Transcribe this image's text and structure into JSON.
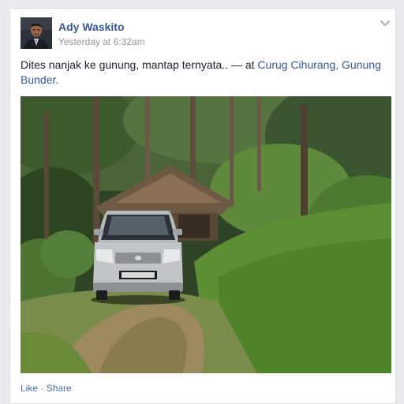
{
  "post": {
    "author_name": "Ady Waskito",
    "timestamp": "Yesterday at 6:32am",
    "message": "Dites nanjak ke gunung, mantap ternyata..",
    "at_separator": " — at ",
    "location": "Curug Cihurang, Gunung Bunder",
    "location_suffix": ".",
    "options_icon": "chevron-down-icon",
    "photo_subject": "silver-minivan-on-grassy-forest-path"
  },
  "actions": {
    "like_label": "Like",
    "separator": " · ",
    "share_label": "Share"
  },
  "colors": {
    "link": "#365899",
    "text": "#1d2129",
    "meta": "#90949c",
    "background": "#e9ebee"
  }
}
